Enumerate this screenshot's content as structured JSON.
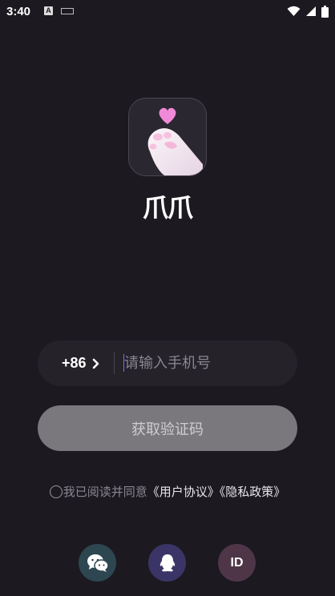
{
  "status_bar": {
    "time": "3:40",
    "icon_a": "A"
  },
  "app": {
    "name": "爪爪",
    "logo_icon": "cat-paw-heart-icon"
  },
  "login": {
    "country_code": "+86",
    "phone_placeholder": "请输入手机号",
    "phone_value": "",
    "get_code_label": "获取验证码"
  },
  "agreement": {
    "prefix": "我已阅读并同意",
    "user_agreement": "《用户协议》",
    "privacy_policy": "《隐私政策》",
    "checked": false
  },
  "social_login": {
    "wechat_icon": "wechat-icon",
    "qq_icon": "qq-icon",
    "id_label": "ID"
  },
  "colors": {
    "background": "#1c1920",
    "field_bg": "#25222a",
    "button_disabled": "#7a787d",
    "caret": "#7a6cff",
    "heart": "#f08ad8",
    "wechat_bg": "#2d4650",
    "qq_bg": "#3a3566",
    "id_bg": "#4f3548"
  }
}
